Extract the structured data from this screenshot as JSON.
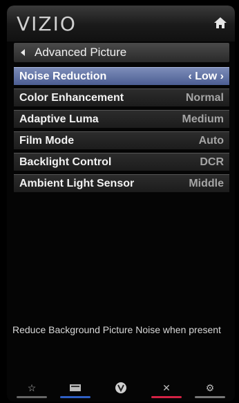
{
  "header": {
    "brand": "VIZIO",
    "home_icon": "home-icon"
  },
  "breadcrumb": {
    "title": "Advanced Picture",
    "back_icon": "back-arrow-icon"
  },
  "menu": {
    "items": [
      {
        "label": "Noise Reduction",
        "value": "Low",
        "selected": true
      },
      {
        "label": "Color Enhancement",
        "value": "Normal",
        "selected": false
      },
      {
        "label": "Adaptive Luma",
        "value": "Medium",
        "selected": false
      },
      {
        "label": "Film Mode",
        "value": "Auto",
        "selected": false
      },
      {
        "label": "Backlight Control",
        "value": "DCR",
        "selected": false
      },
      {
        "label": "Ambient Light Sensor",
        "value": "Middle",
        "selected": false
      }
    ]
  },
  "help_text": "Reduce Background Picture Noise when present",
  "bottom_bar": {
    "buttons": [
      {
        "icon": "star-icon",
        "color": "#666666"
      },
      {
        "icon": "menu-icon",
        "color": "#2f5fc4"
      },
      {
        "icon": "vizio-v-icon",
        "color": "#777777"
      },
      {
        "icon": "close-icon",
        "color": "#d32244"
      },
      {
        "icon": "gear-icon",
        "color": "#777777"
      }
    ]
  },
  "colors": {
    "selected_row": "#5c6ea3",
    "panel": "#050505"
  }
}
